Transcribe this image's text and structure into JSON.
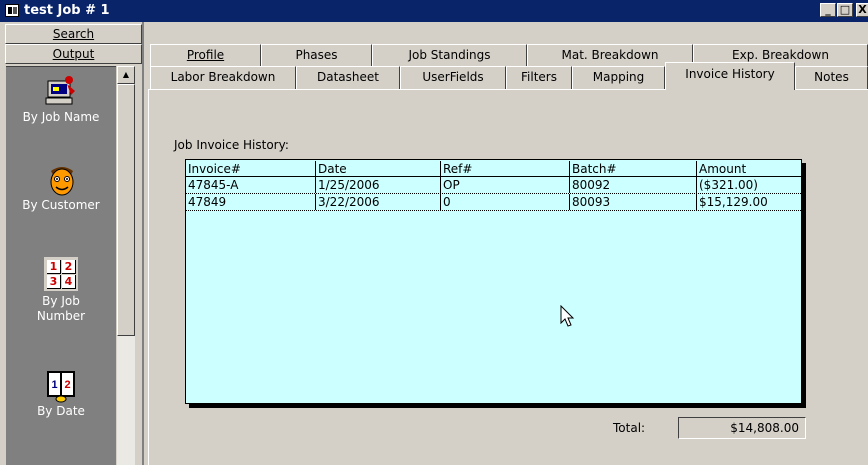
{
  "window": {
    "title": "test Job # 1",
    "min_glyph": "_",
    "max_glyph": "□",
    "close_glyph": "X"
  },
  "sidebar": {
    "groups": [
      {
        "label": "Search"
      },
      {
        "label": "Output"
      }
    ],
    "shortcuts": [
      {
        "label": "By Job Name",
        "icon": "computer-person-icon"
      },
      {
        "label": "By Customer",
        "icon": "face-icon"
      },
      {
        "label": "By Job Number",
        "icon": "number-grid-icon"
      },
      {
        "label": "By Date",
        "icon": "calendar-book-icon"
      }
    ],
    "number_grid_digits": [
      "1",
      "2",
      "3",
      "4"
    ],
    "calendar_digits": "1|2"
  },
  "tabs": {
    "row1": [
      "Profile",
      "Phases",
      "Job Standings",
      "Mat. Breakdown",
      "Exp. Breakdown"
    ],
    "row2": [
      "Labor Breakdown",
      "Datasheet",
      "UserFields",
      "Filters",
      "Mapping",
      "Invoice History",
      "Notes"
    ],
    "active": "Invoice History"
  },
  "invoice_history": {
    "label": "Job Invoice History:",
    "columns": [
      "Invoice#",
      "Date",
      "Ref#",
      "Batch#",
      "Amount"
    ],
    "rows": [
      [
        "47845-A",
        "1/25/2006",
        "OP",
        "80092",
        "($321.00)"
      ],
      [
        "47849",
        "3/22/2006",
        "0",
        "80093",
        "$15,129.00"
      ]
    ],
    "total_label": "Total:",
    "total_value": "$14,808.00"
  },
  "colors": {
    "title_bar": "#0a246a",
    "grid_background": "#ccffff",
    "shortcut_pane": "#808080",
    "face_tone": "#ff9900"
  }
}
